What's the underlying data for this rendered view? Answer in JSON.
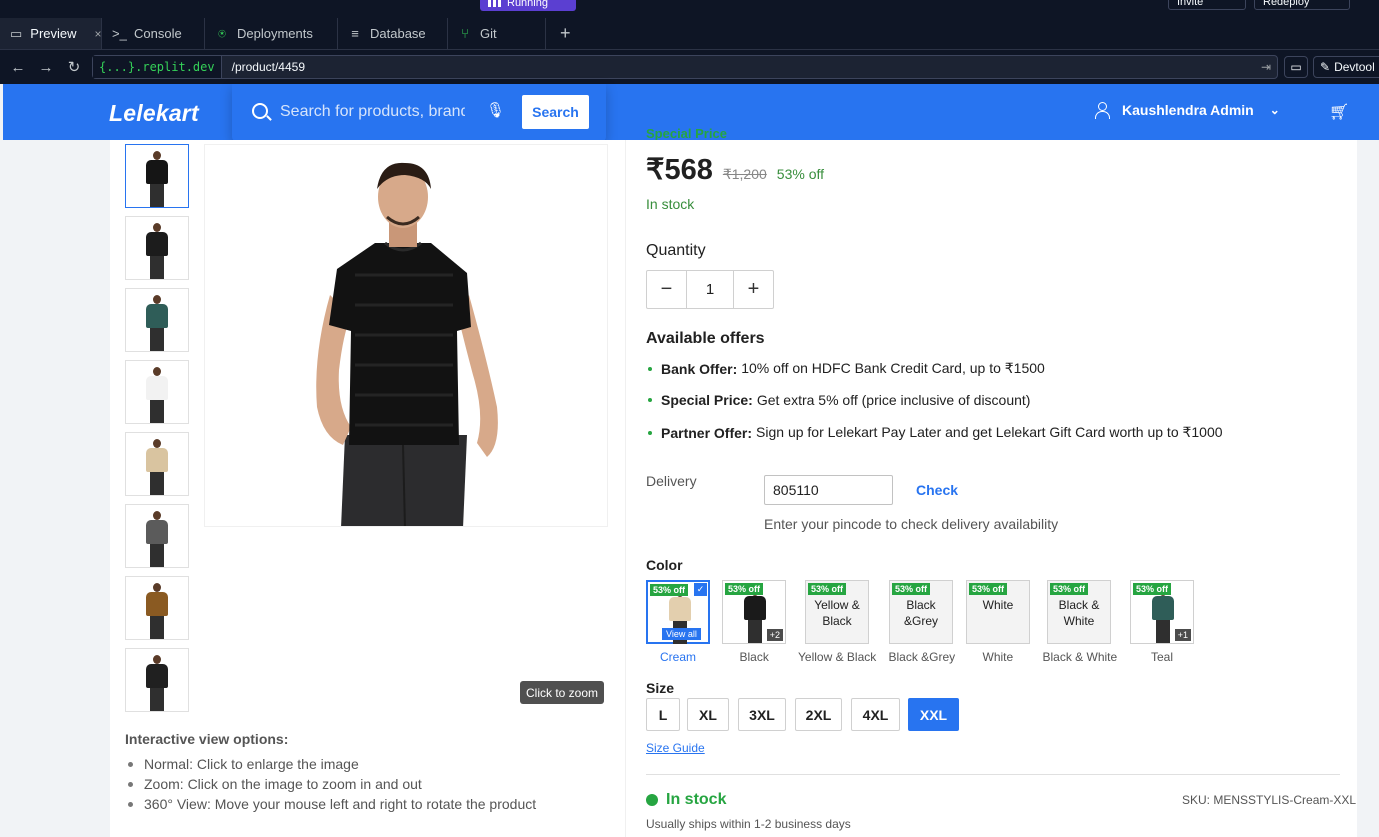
{
  "browser": {
    "status_label": "Running",
    "top_right_buttons": [
      "Invite",
      "Redeploy"
    ],
    "tabs": [
      {
        "label": "Preview",
        "icon": "monitor-icon",
        "active": true
      },
      {
        "label": "Console",
        "icon": "terminal-icon",
        "active": false
      },
      {
        "label": "Deployments",
        "icon": "deploy-icon",
        "active": false
      },
      {
        "label": "Database",
        "icon": "database-icon",
        "active": false
      },
      {
        "label": "Git",
        "icon": "git-icon",
        "active": false
      }
    ],
    "url_host_prefix": "{...}",
    "url_host": ".replit.dev",
    "url_path": "/product/4459",
    "devtools_label": "Devtool"
  },
  "header": {
    "logo": "Lelekart",
    "search_placeholder": "Search for products, brands and more",
    "search_button": "Search",
    "user_name": "Kaushlendra Admin",
    "colors": {
      "brand": "#2874f0"
    }
  },
  "gallery": {
    "thumbnails": [
      {
        "shirt_color": "#151515"
      },
      {
        "shirt_color": "#1c1c1c"
      },
      {
        "shirt_color": "#2f5d58"
      },
      {
        "shirt_color": "#f2f2f2"
      },
      {
        "shirt_color": "#d9c4a0"
      },
      {
        "shirt_color": "#5b5b5b"
      },
      {
        "shirt_color": "#8a5a22"
      },
      {
        "shirt_color": "#202020"
      }
    ],
    "zoom_tip": "Click to zoom",
    "interactive_title": "Interactive view options:",
    "interactive_options": [
      "Normal: Click to enlarge the image",
      "Zoom: Click on the image to zoom in and out",
      "360° View: Move your mouse left and right to rotate the product"
    ]
  },
  "product": {
    "special_price_label": "Special Price",
    "price": "₹568",
    "mrp": "₹1,200",
    "discount": "53% off",
    "stock": "In stock",
    "quantity_label": "Quantity",
    "quantity": "1",
    "offers_title": "Available offers",
    "offers": [
      {
        "title": "Bank Offer:",
        "text": "10% off on HDFC Bank Credit Card, up to ₹1500"
      },
      {
        "title": "Special Price:",
        "text": "Get extra 5% off (price inclusive of discount)"
      },
      {
        "title": "Partner Offer:",
        "text": "Sign up for Lelekart Pay Later and get Lelekart Gift Card worth up to ₹1000"
      }
    ],
    "delivery_label": "Delivery",
    "pincode": "805110",
    "check_label": "Check",
    "delivery_hint": "Enter your pincode to check delivery availability",
    "color_label": "Color",
    "colors": [
      {
        "name": "Cream",
        "badge": "53% off",
        "inner": "",
        "extra": "View all",
        "selected": true,
        "swatch": "#e3cfae"
      },
      {
        "name": "Black",
        "badge": "53% off",
        "inner": "",
        "extra": "+2",
        "selected": false,
        "swatch": "#1a1a1a"
      },
      {
        "name": "Yellow & Black",
        "badge": "53% off",
        "inner": "Yellow & Black",
        "extra": "",
        "selected": false,
        "swatch": ""
      },
      {
        "name": "Black &Grey",
        "badge": "53% off",
        "inner": "Black &Grey",
        "extra": "",
        "selected": false,
        "swatch": ""
      },
      {
        "name": "White",
        "badge": "53% off",
        "inner": "White",
        "extra": "",
        "selected": false,
        "swatch": ""
      },
      {
        "name": "Black & White",
        "badge": "53% off",
        "inner": "Black & White",
        "extra": "",
        "selected": false,
        "swatch": ""
      },
      {
        "name": "Teal",
        "badge": "53% off",
        "inner": "",
        "extra": "+1",
        "selected": false,
        "swatch": "#2f5d58"
      }
    ],
    "size_label": "Size",
    "sizes": [
      "L",
      "XL",
      "3XL",
      "2XL",
      "4XL",
      "XXL"
    ],
    "selected_size": "XXL",
    "size_guide": "Size Guide",
    "stock_status": "In stock",
    "sku": "SKU: MENSSTYLIS-Cream-XXL",
    "shipping_note": "Usually ships within 1-2 business days"
  }
}
